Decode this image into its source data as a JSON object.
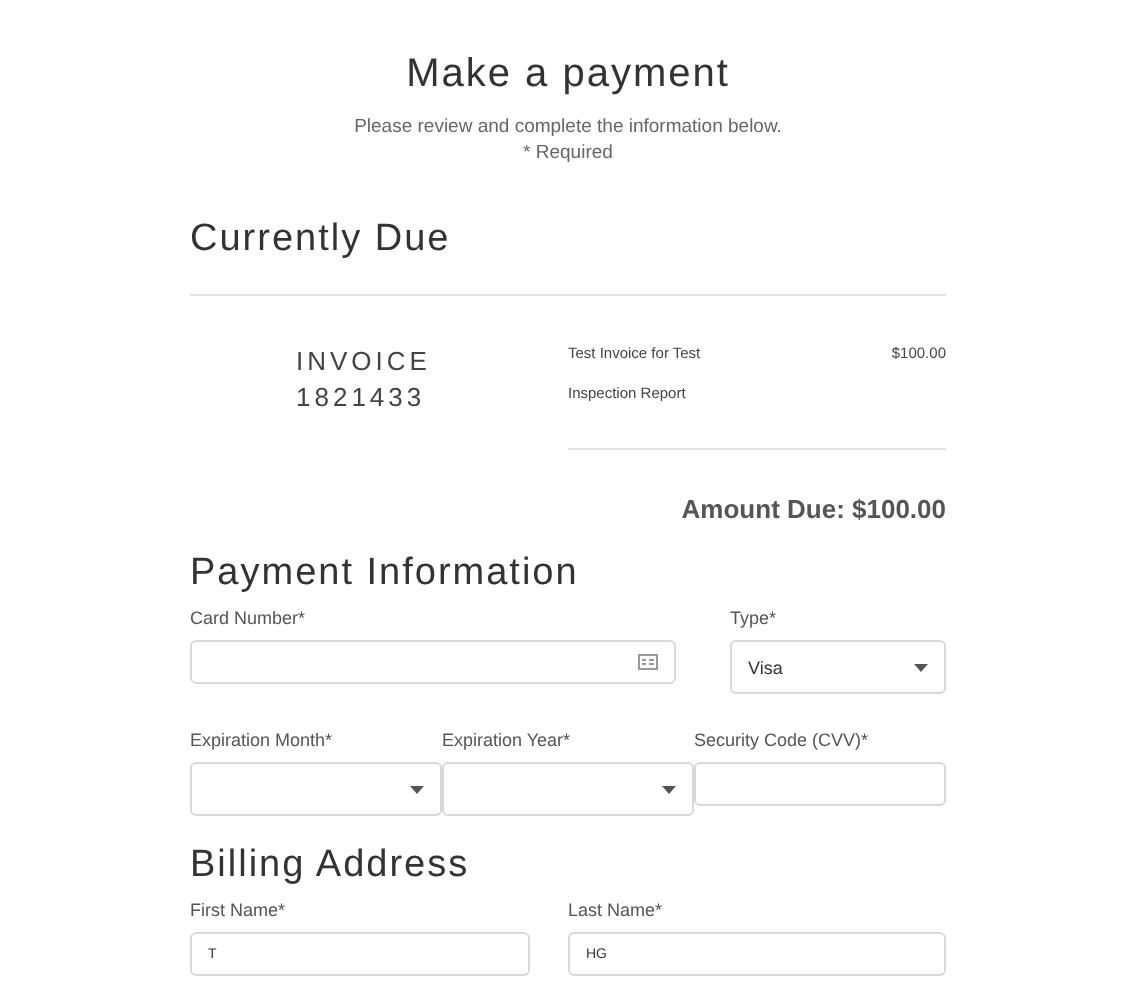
{
  "title": "Make a payment",
  "subtitle": "Please review and complete the information below.",
  "required_note": "* Required",
  "currently_due": {
    "heading": "Currently Due",
    "invoice_label": "INVOICE",
    "invoice_number": "1821433",
    "line_items": [
      {
        "description": "Test Invoice for Test",
        "amount": "$100.00"
      },
      {
        "description": "Inspection Report"
      }
    ],
    "amount_due": "Amount Due: $100.00"
  },
  "payment_information": {
    "heading": "Payment Information",
    "fields": [
      {
        "kind": "card",
        "label": "Card Number*"
      },
      {
        "kind": "select",
        "label": "Type*",
        "value": "Visa"
      },
      {
        "kind": "select",
        "label": "Expiration Month*"
      },
      {
        "kind": "select",
        "label": "Expiration Year*"
      },
      {
        "kind": "text",
        "label": "Security Code (CVV)*"
      }
    ]
  },
  "billing_address": {
    "heading": "Billing Address",
    "fields": [
      {
        "kind": "text",
        "label": "First Name*",
        "value": "T"
      },
      {
        "kind": "text",
        "label": "Last Name*",
        "value": "HG"
      }
    ]
  }
}
